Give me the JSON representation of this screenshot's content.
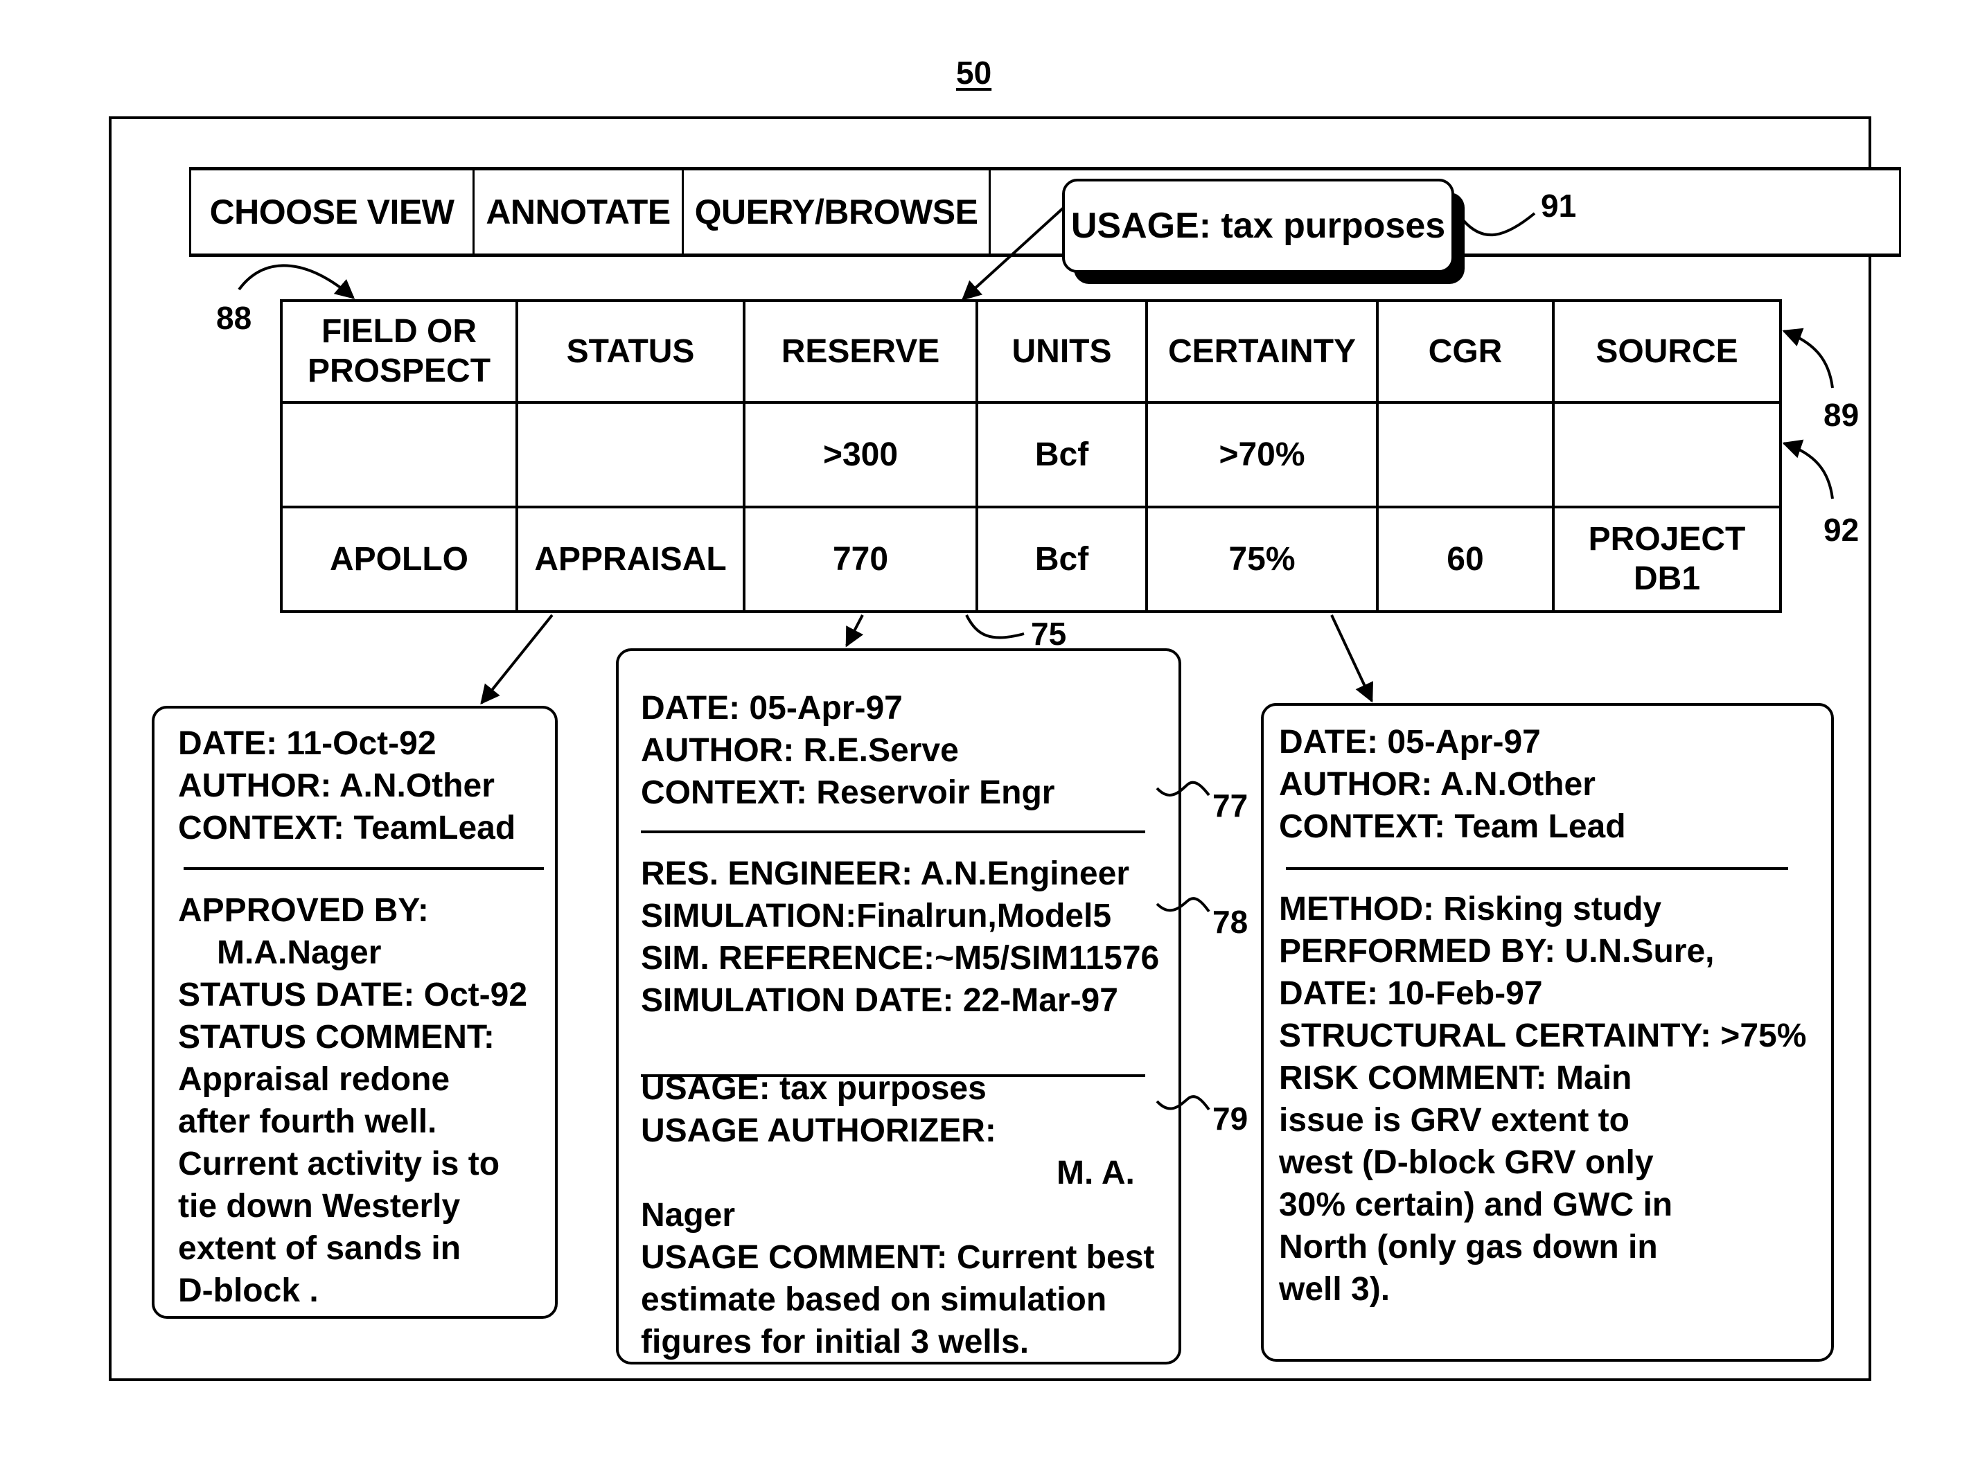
{
  "figure_label": "50",
  "toolbar": {
    "buttons": [
      "CHOOSE VIEW",
      "ANNOTATE",
      "QUERY/BROWSE"
    ]
  },
  "tooltip": {
    "text": "USAGE: tax purposes"
  },
  "refs": {
    "r88": "88",
    "r89": "89",
    "r91": "91",
    "r92": "92",
    "r75": "75",
    "r77": "77",
    "r78": "78",
    "r79": "79"
  },
  "table": {
    "headers": [
      "FIELD OR PROSPECT",
      "STATUS",
      "RESERVE",
      "UNITS",
      "CERTAINTY",
      "CGR",
      "SOURCE"
    ],
    "header_lines": {
      "field_1": "FIELD OR",
      "field_2": "PROSPECT"
    },
    "query_row": [
      "",
      "",
      ">300",
      "Bcf",
      ">70%",
      "",
      ""
    ],
    "data_row": [
      "APOLLO",
      "APPRAISAL",
      "770",
      "Bcf",
      "75%",
      "60",
      "PROJECT DB1"
    ],
    "source_lines": {
      "l1": "PROJECT",
      "l2": "DB1"
    }
  },
  "panels": {
    "left": {
      "header": [
        "DATE: 11-Oct-92",
        "AUTHOR: A.N.Other",
        "CONTEXT: TeamLead"
      ],
      "body": [
        "APPROVED BY:",
        "M.A.Nager",
        "STATUS DATE: Oct-92",
        "STATUS COMMENT:",
        "Appraisal redone",
        "after fourth well.",
        "Current activity is to",
        "tie down Westerly",
        "extent of sands in",
        "D-block ."
      ]
    },
    "middle": {
      "header": [
        "DATE: 05-Apr-97",
        "AUTHOR: R.E.Serve",
        "CONTEXT: Reservoir Engr"
      ],
      "simulation": [
        "RES. ENGINEER: A.N.Engineer",
        "SIMULATION:Finalrun,Model5",
        "SIM. REFERENCE:~M5/SIM11576",
        "SIMULATION DATE: 22-Mar-97"
      ],
      "usage": [
        "USAGE: tax purposes",
        "USAGE AUTHORIZER:",
        "M. A.",
        "Nager",
        "USAGE COMMENT: Current best",
        "estimate based on simulation",
        "figures for initial 3 wells."
      ]
    },
    "right": {
      "header": [
        "DATE: 05-Apr-97",
        "AUTHOR: A.N.Other",
        "CONTEXT: Team Lead"
      ],
      "body": [
        "METHOD: Risking study",
        "PERFORMED BY: U.N.Sure,",
        "DATE: 10-Feb-97",
        "STRUCTURAL CERTAINTY: >75%",
        "RISK COMMENT: Main",
        "issue is GRV extent to",
        "west (D-block GRV only",
        "30% certain) and GWC in",
        "North (only gas down in",
        "well 3)."
      ]
    }
  }
}
